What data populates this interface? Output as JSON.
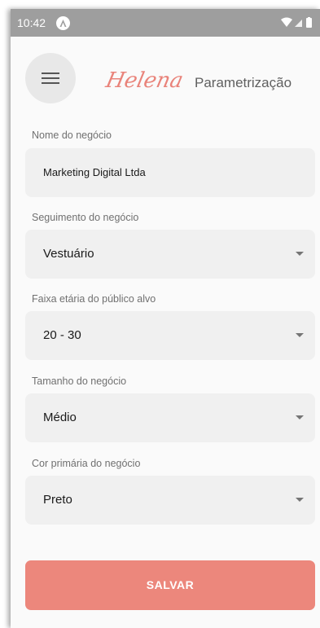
{
  "status_bar": {
    "time": "10:42",
    "app_icon": "android-app-icon",
    "icons": [
      "wifi-icon",
      "signal-icon",
      "battery-icon"
    ]
  },
  "header": {
    "menu_icon": "hamburger-menu-icon",
    "logo_text": "Helena",
    "title": "Parametrização"
  },
  "form": {
    "business_name": {
      "label": "Nome do negócio",
      "value": "Marketing Digital Ltda"
    },
    "segment": {
      "label": "Seguimento do negócio",
      "value": "Vestuário"
    },
    "age_range": {
      "label": "Faixa etária do público alvo",
      "value": "20 - 30"
    },
    "size": {
      "label": "Tamanho do negócio",
      "value": "Médio"
    },
    "primary_color": {
      "label": "Cor primária do negócio",
      "value": "Preto"
    }
  },
  "save_button": {
    "label": "SALVAR"
  },
  "colors": {
    "accent": "#ec877c",
    "logo": "#e9837a",
    "field_bg": "#f0f0f0"
  }
}
